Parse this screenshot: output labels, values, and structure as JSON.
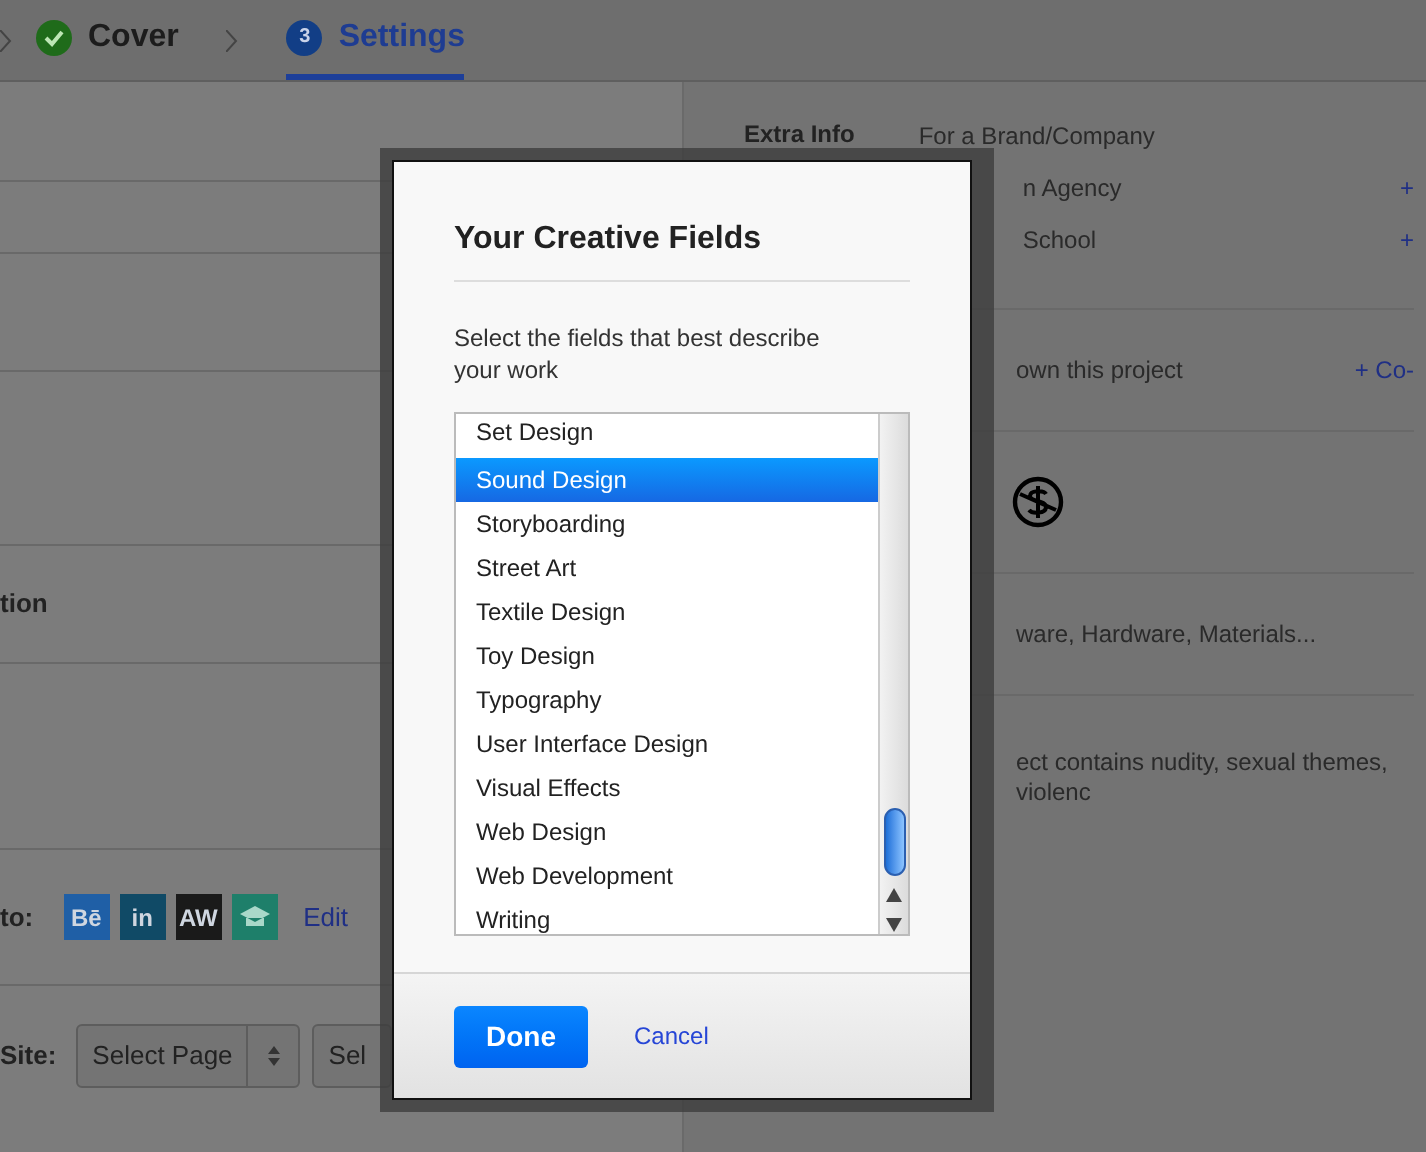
{
  "steps": [
    {
      "kind": "done",
      "label": "Cover",
      "selected": false
    },
    {
      "kind": "number",
      "number": "3",
      "label": "Settings",
      "selected": true
    }
  ],
  "left_panel": {
    "section_label": "tion",
    "share_label": "to:",
    "share_buttons": [
      {
        "kind": "text",
        "text": "Bē",
        "color": "#1f5fa6"
      },
      {
        "kind": "text",
        "text": "in",
        "color": "#104a66"
      },
      {
        "kind": "text",
        "text": "AW",
        "color": "#1a1a1a"
      },
      {
        "kind": "icon",
        "color": "#1e7f6a"
      }
    ],
    "edit_link": "Edit",
    "site_label": "Site:",
    "selects": [
      {
        "kind": "dropdown",
        "value": "Select Page"
      },
      {
        "kind": "partial",
        "value": "Sel"
      }
    ]
  },
  "right_panel": {
    "extra_info_label": "Extra Info",
    "extra_options": [
      {
        "text": "For a Brand/Company"
      },
      {
        "text": "n Agency",
        "action": "+"
      },
      {
        "text": "School",
        "action": "+"
      }
    ],
    "owners": {
      "text": "own this project",
      "action": "+ Co-"
    },
    "tools": "ware, Hardware, Materials...",
    "mature": "ect contains nudity, sexual themes, violenc"
  },
  "dialog": {
    "title": "Your Creative Fields",
    "description": "Select the fields that best describe your work",
    "fields": [
      {
        "label": "Set Design",
        "selected": false
      },
      {
        "label": "Sound Design",
        "selected": true
      },
      {
        "label": "Storyboarding",
        "selected": false
      },
      {
        "label": "Street Art",
        "selected": false
      },
      {
        "label": "Textile Design",
        "selected": false
      },
      {
        "label": "Toy Design",
        "selected": false
      },
      {
        "label": "Typography",
        "selected": false
      },
      {
        "label": "User Interface Design",
        "selected": false
      },
      {
        "label": "Visual Effects",
        "selected": false
      },
      {
        "label": "Web Design",
        "selected": false
      },
      {
        "label": "Web Development",
        "selected": false
      },
      {
        "label": "Writing",
        "selected": false
      }
    ],
    "done_button": "Done",
    "cancel_link": "Cancel"
  }
}
